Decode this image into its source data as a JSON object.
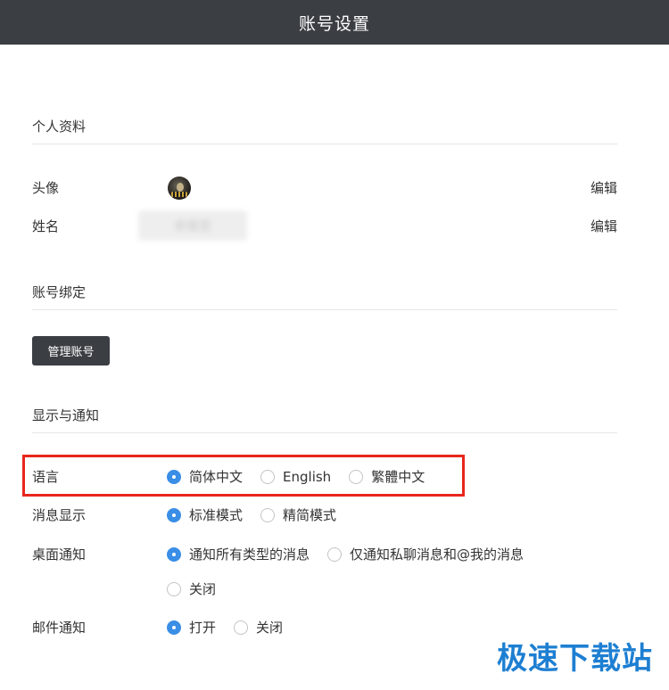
{
  "header": {
    "title": "账号设置"
  },
  "profile": {
    "section_title": "个人资料",
    "avatar_label": "头像",
    "name_label": "姓名",
    "name_value": "余俊宏",
    "edit_label": "编辑"
  },
  "binding": {
    "section_title": "账号绑定",
    "manage_label": "管理账号"
  },
  "display": {
    "section_title": "显示与通知",
    "language": {
      "label": "语言",
      "options": [
        "简体中文",
        "English",
        "繁體中文"
      ],
      "selected": "简体中文"
    },
    "message_display": {
      "label": "消息显示",
      "options": [
        "标准模式",
        "精简模式"
      ],
      "selected": "标准模式"
    },
    "desktop_notify": {
      "label": "桌面通知",
      "options": [
        "通知所有类型的消息",
        "仅通知私聊消息和@我的消息",
        "关闭"
      ],
      "selected": "通知所有类型的消息"
    },
    "email_notify": {
      "label": "邮件通知",
      "options": [
        "打开",
        "关闭"
      ],
      "selected": "打开"
    }
  },
  "colors": {
    "header_bg": "#3b3e43",
    "accent": "#3a8ee6",
    "highlight": "#e8261c",
    "watermark": "#1d7fd2"
  },
  "watermark": "极速下载站"
}
